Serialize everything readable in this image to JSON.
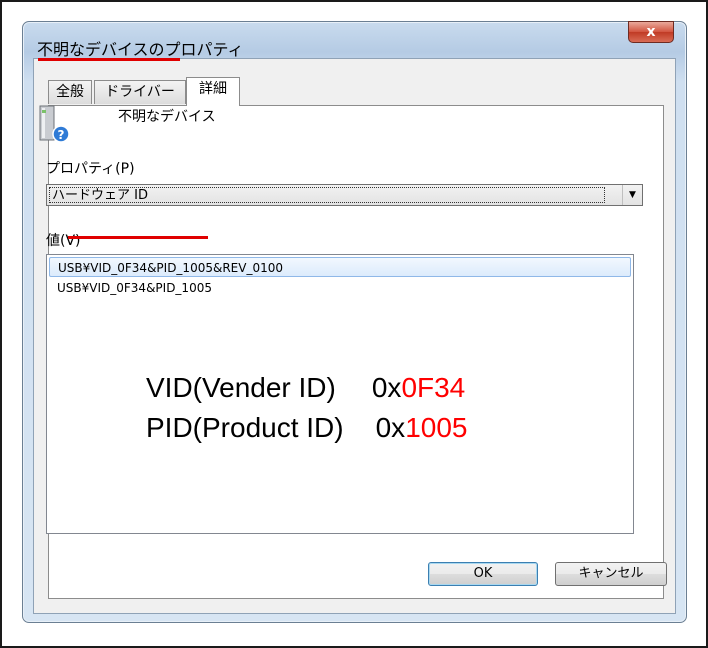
{
  "window": {
    "title": "不明なデバイスのプロパティ",
    "close_label": "x"
  },
  "tabs": [
    {
      "label": "全般"
    },
    {
      "label": "ドライバー"
    },
    {
      "label": "詳細",
      "active": true
    }
  ],
  "device": {
    "name": "不明なデバイス",
    "icon": "unknown-device-icon"
  },
  "property": {
    "label": "プロパティ(P)",
    "selected": "ハードウェア ID",
    "arrow": "▼"
  },
  "value": {
    "label": "値(V)",
    "items": [
      "USB¥VID_0F34&PID_1005&REV_0100",
      "USB¥VID_0F34&PID_1005"
    ]
  },
  "annotation": {
    "vid_label": "VID(Vender ID)",
    "vid_prefix": "0x",
    "vid_value": "0F34",
    "pid_label": "PID(Product ID)",
    "pid_prefix": "0x",
    "pid_value": "1005"
  },
  "buttons": {
    "ok": "OK",
    "cancel": "キャンセル"
  },
  "colors": {
    "highlight_underline": "#e00000",
    "annotation_red": "#ff0000"
  }
}
